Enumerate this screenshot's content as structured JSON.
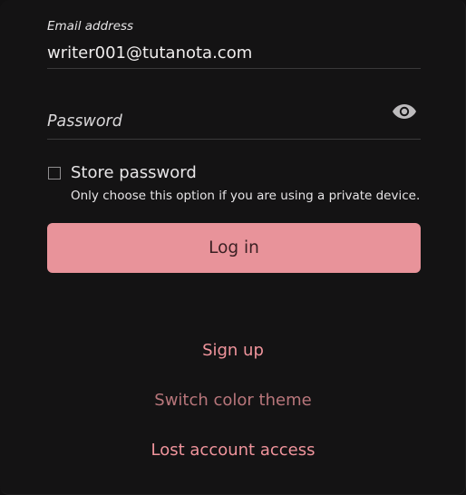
{
  "login_form": {
    "email_label": "Email address",
    "email_value": "writer001@tutanota.com",
    "password_placeholder": "Password",
    "store_password_label": "Store password",
    "store_password_help": "Only choose this option if you are using a private device.",
    "login_button": "Log in"
  },
  "links": {
    "sign_up": "Sign up",
    "switch_theme": "Switch color theme",
    "lost_access": "Lost account access"
  },
  "colors": {
    "background": "#141314",
    "accent": "#e8939a",
    "link": "#f0949c",
    "link_muted": "#b8767b"
  },
  "icons": {
    "password_toggle": "eye-icon"
  }
}
